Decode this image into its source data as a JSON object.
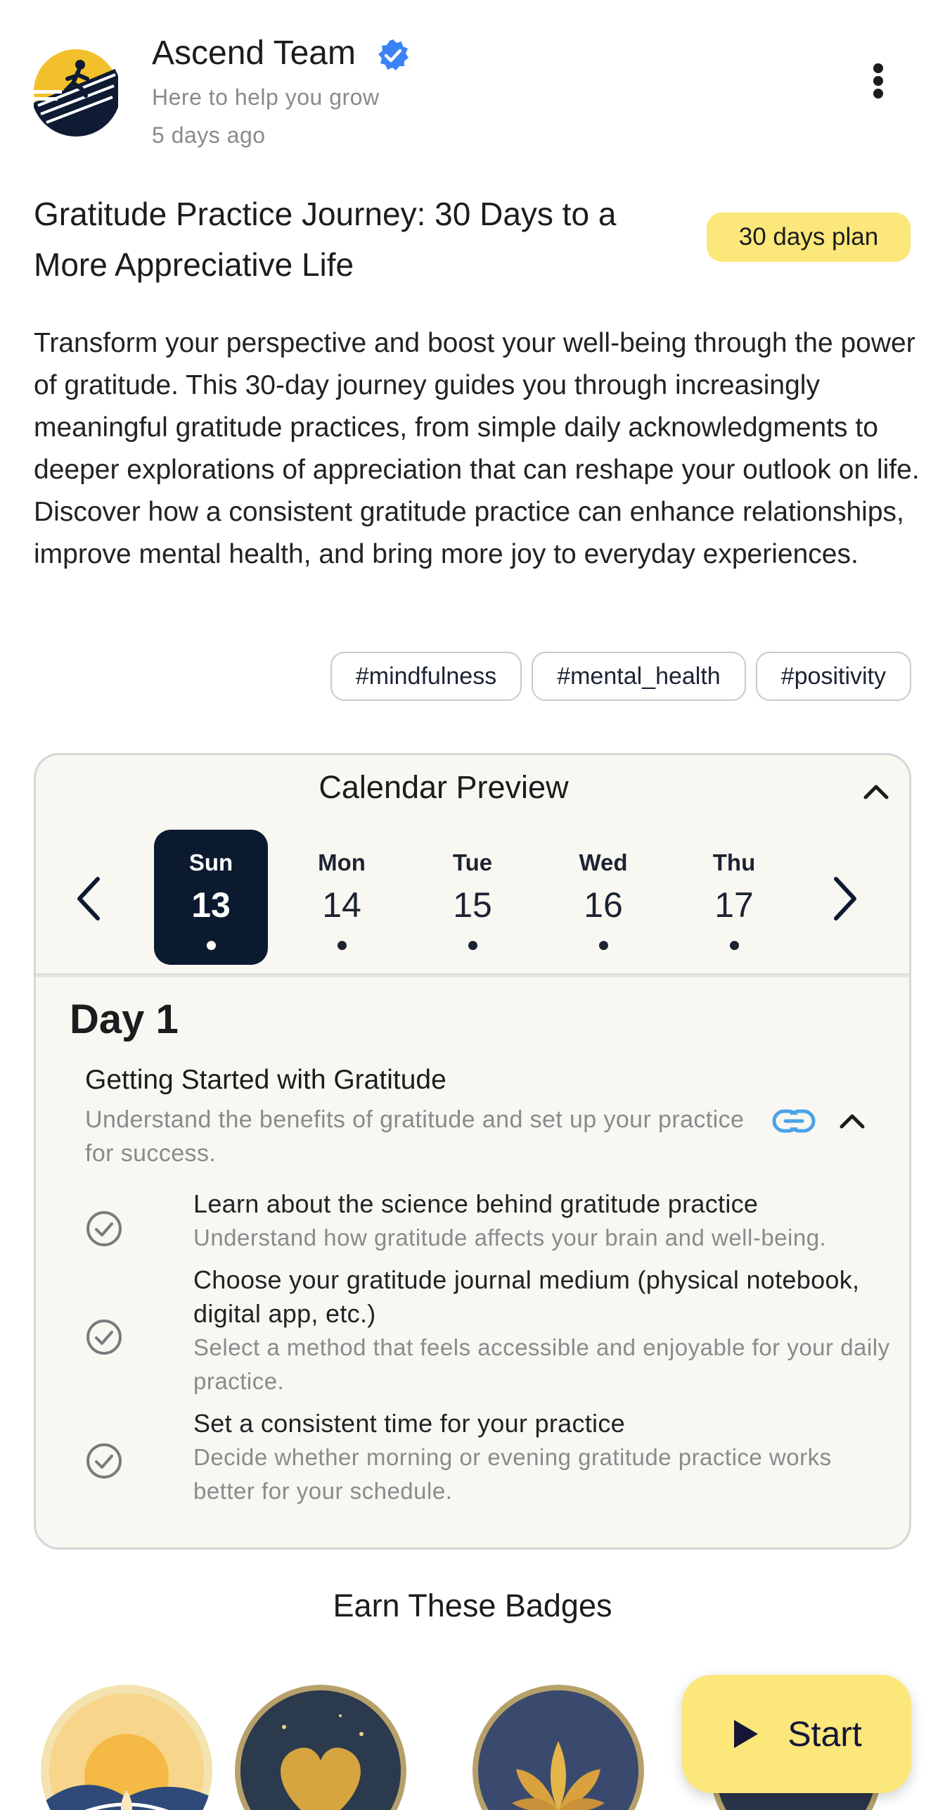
{
  "author": {
    "name": "Ascend Team",
    "tagline": "Here to help you grow",
    "posted": "5 days ago"
  },
  "post": {
    "title": "Gratitude Practice Journey: 30 Days to a More Appreciative Life",
    "plan_badge": "30 days plan",
    "description": "Transform your perspective and boost your well-being through the power of gratitude. This 30-day journey guides you through increasingly meaningful gratitude practices, from simple daily acknowledgments to deeper explorations of appreciation that can reshape your outlook on life. Discover how a consistent gratitude practice can enhance relationships, improve mental health, and bring more joy to everyday experiences.",
    "tags": [
      "#mindfulness",
      "#mental_health",
      "#positivity"
    ]
  },
  "calendar": {
    "title": "Calendar Preview",
    "days": [
      {
        "name": "Sun",
        "num": "13",
        "selected": true
      },
      {
        "name": "Mon",
        "num": "14",
        "selected": false
      },
      {
        "name": "Tue",
        "num": "15",
        "selected": false
      },
      {
        "name": "Wed",
        "num": "16",
        "selected": false
      },
      {
        "name": "Thu",
        "num": "17",
        "selected": false
      }
    ],
    "day_heading": "Day 1",
    "task": {
      "title": "Getting Started with Gratitude",
      "subtitle": "Understand the benefits of gratitude and set up your practice for success.",
      "items": [
        {
          "title": "Learn about the science behind gratitude practice",
          "desc": "Understand how gratitude affects your brain and well-being."
        },
        {
          "title": "Choose your gratitude journal medium (physical notebook, digital app, etc.)",
          "desc": "Select a method that feels accessible and enjoyable for your daily practice."
        },
        {
          "title": "Set a consistent time for your practice",
          "desc": "Decide whether morning or evening gratitude practice works better for your schedule."
        }
      ]
    }
  },
  "badges": {
    "title": "Earn These Badges"
  },
  "start": {
    "label": "Start"
  },
  "colors": {
    "accent_yellow": "#fbe77a",
    "navy": "#0c1a30",
    "verified_blue": "#3b82f6",
    "link_blue": "#4aa3e8",
    "muted_text": "#8a8a8e"
  }
}
